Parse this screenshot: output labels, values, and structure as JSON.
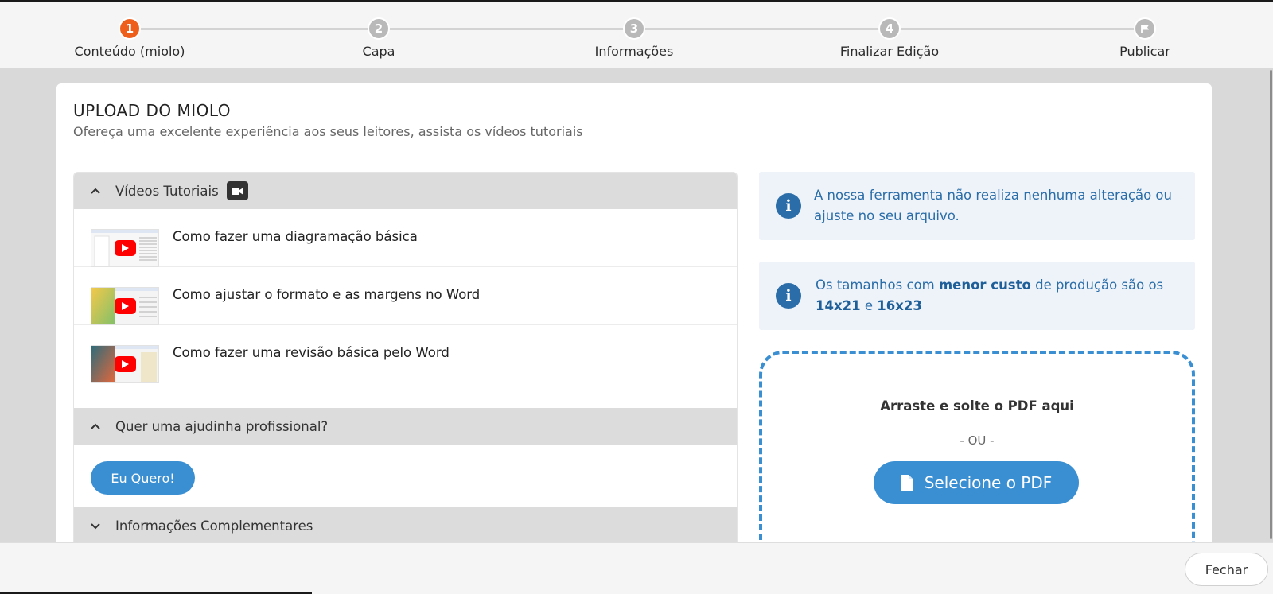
{
  "steps": [
    {
      "number": "1",
      "label": "Conteúdo (miolo)"
    },
    {
      "number": "2",
      "label": "Capa"
    },
    {
      "number": "3",
      "label": "Informações"
    },
    {
      "number": "4",
      "label": "Finalizar Edição"
    },
    {
      "number": "",
      "label": "Publicar"
    }
  ],
  "colors": {
    "active_step": "#ef5f1c",
    "inactive_step": "#b9b9b9",
    "primary": "#3a8fd3",
    "info_text": "#2a6da8",
    "info_bg": "#eef3fa"
  },
  "page": {
    "title": "UPLOAD DO MIOLO",
    "subtitle": "Ofereça uma excelente experiência aos seus leitores, assista os vídeos tutoriais"
  },
  "tutorials": {
    "header": "Vídeos Tutoriais",
    "videos": [
      {
        "title": "Como fazer uma diagramação básica"
      },
      {
        "title": "Como ajustar o formato e as margens no Word"
      },
      {
        "title": "Como fazer uma revisão básica pelo Word"
      }
    ]
  },
  "help": {
    "header": "Quer uma ajudinha profissional?",
    "button": "Eu Quero!"
  },
  "complementary": {
    "header": "Informações Complementares"
  },
  "info1": {
    "text": "A nossa ferramenta não realiza nenhuma alteração ou ajuste no seu arquivo."
  },
  "info2": {
    "part1": "Os tamanhos com ",
    "bold1": "menor custo",
    "part2": " de produção são os ",
    "bold2": "14x21",
    "part3": " e ",
    "bold3": "16x23"
  },
  "dropzone": {
    "title": "Arraste e solte o PDF aqui",
    "or": "- OU -",
    "button": "Selecione o PDF"
  },
  "footer": {
    "close": "Fechar"
  }
}
